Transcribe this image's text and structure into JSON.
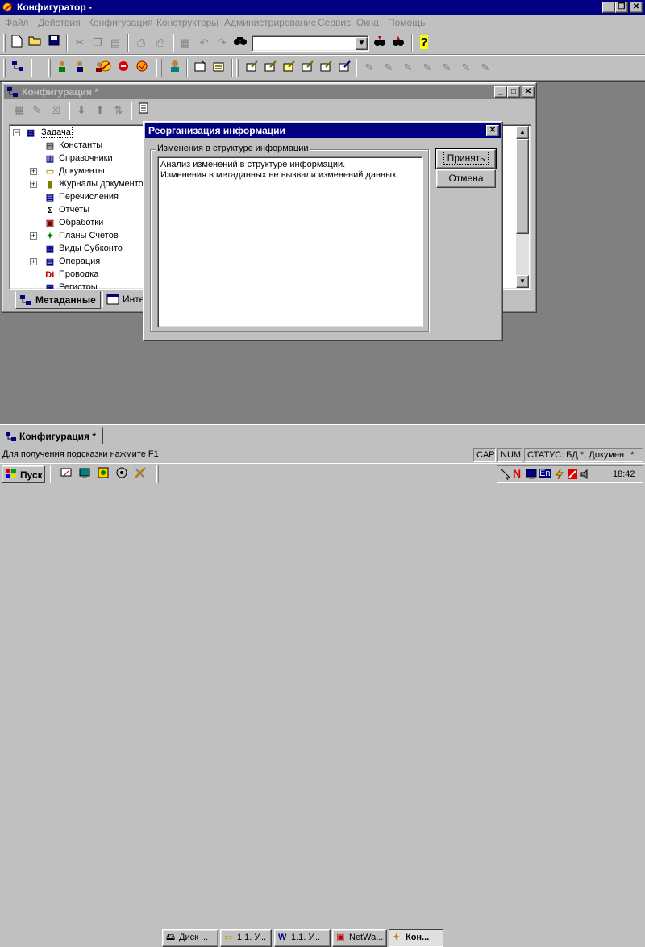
{
  "app": {
    "title": "Конфигуратор -",
    "icon": "configurator-icon",
    "controls": {
      "minimize": "_",
      "restore": "❐",
      "close": "✕"
    }
  },
  "menu": [
    "Файл",
    "Действия",
    "Конфигурация",
    "Конструкторы",
    "Администрирование",
    "Сервис",
    "Окна",
    "Помощь"
  ],
  "toolbar": {
    "combo_value": "",
    "icons1": [
      "new-document-icon",
      "open-folder-icon",
      "save-icon",
      "cut-icon",
      "copy-icon",
      "paste-icon",
      "print-icon",
      "print-preview-icon",
      "properties-icon",
      "undo-icon",
      "redo-icon",
      "find-icon",
      "find-next-icon",
      "find-prev-icon",
      "help-icon"
    ],
    "icons2": [
      "structure-icon",
      "users-icon",
      "rights-icon",
      "debugger-icon",
      "stop-icon",
      "config-check-icon",
      "syntax-icon",
      "module-icon",
      "form-icon",
      "edit-1-icon",
      "edit-2-icon",
      "edit-3-icon",
      "edit-4-icon",
      "edit-5-icon",
      "edit-6-icon",
      "wizard-1-icon",
      "wizard-2-icon",
      "wizard-3-icon",
      "wizard-4-icon",
      "wizard-5-icon",
      "wizard-6-icon",
      "wizard-7-icon"
    ]
  },
  "config_window": {
    "title": "Конфигурация *",
    "tree": [
      {
        "label": "Задача",
        "icon": "task-icon",
        "level": 0,
        "expander": "−",
        "selected": true
      },
      {
        "label": "Константы",
        "icon": "constants-icon",
        "level": 1,
        "expander": ""
      },
      {
        "label": "Справочники",
        "icon": "catalogs-icon",
        "level": 1,
        "expander": ""
      },
      {
        "label": "Документы",
        "icon": "documents-folder-icon",
        "level": 1,
        "expander": "+"
      },
      {
        "label": "Журналы документо",
        "icon": "journals-icon",
        "level": 1,
        "expander": "+"
      },
      {
        "label": "Перечисления",
        "icon": "enums-icon",
        "level": 1,
        "expander": ""
      },
      {
        "label": "Отчеты",
        "icon": "reports-icon",
        "level": 1,
        "expander": ""
      },
      {
        "label": "Обработки",
        "icon": "processing-icon",
        "level": 1,
        "expander": ""
      },
      {
        "label": "Планы Счетов",
        "icon": "chart-of-accounts-icon",
        "level": 1,
        "expander": "+"
      },
      {
        "label": "Виды Субконто",
        "icon": "subconto-icon",
        "level": 1,
        "expander": ""
      },
      {
        "label": "Операция",
        "icon": "operation-icon",
        "level": 1,
        "expander": "+"
      },
      {
        "label": "Проводка",
        "icon": "posting-icon",
        "level": 1,
        "expander": ""
      },
      {
        "label": "Регистры",
        "icon": "registers-icon",
        "level": 1,
        "expander": ""
      }
    ],
    "tabs": [
      {
        "label": "Метаданные",
        "icon": "metadata-icon",
        "active": true
      },
      {
        "label": "Инте",
        "icon": "interfaces-icon",
        "active": false
      }
    ]
  },
  "dialog": {
    "title": "Реорганизация информации",
    "group_label": "Изменения в структуре информации",
    "lines": [
      "Анализ изменений в структуре информации.",
      "Изменения в метаданных не вызвали изменений данных."
    ],
    "accept_label": "Принять",
    "cancel_label": "Отмена"
  },
  "window_tab": {
    "label": "Конфигурация *"
  },
  "statusbar": {
    "hint": "Для получения подсказки нажмите F1",
    "cap": "CAP",
    "num": "NUM",
    "status": "СТАТУС: БД *, Документ *"
  },
  "taskbar": {
    "start_label": "Пуск",
    "quick_icons": [
      "desktop-icon",
      "explorer-icon",
      "outlook-icon",
      "1c-icon",
      "tools-icon"
    ],
    "tasks": [
      {
        "label": "Диск ...",
        "icon": "disk-icon"
      },
      {
        "label": "1.1. У...",
        "icon": "folder-icon"
      },
      {
        "label": "1.1. У...",
        "icon": "word-icon"
      },
      {
        "label": "NetWa...",
        "icon": "netware-icon"
      },
      {
        "label": "Кон...",
        "icon": "configurator-task-icon",
        "active": true
      }
    ],
    "tray_icons": [
      "arrow-icon",
      "norton-icon",
      "monitor-icon",
      "lang-icon",
      "power-icon",
      "antivirus-icon",
      "volume-icon"
    ],
    "lang": "En",
    "clock": "18:42"
  },
  "colors": {
    "titlebar_active": "#000080",
    "titlebar_inactive": "#808080",
    "face": "#c0c0c0",
    "workspace": "#808080"
  }
}
